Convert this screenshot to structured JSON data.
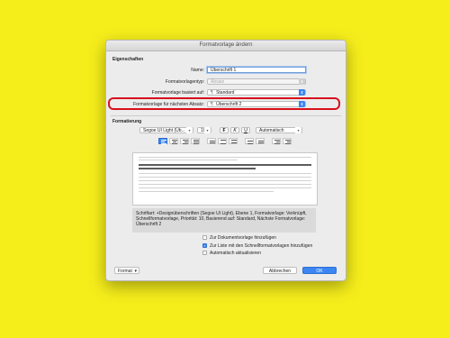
{
  "window": {
    "title": "Formatvorlage ändern"
  },
  "properties": {
    "heading": "Eigenschaften",
    "name_label": "Name:",
    "name_value": "Überschrift 1",
    "type_label": "Formatvorlagentyp:",
    "type_value": "Absatz",
    "based_on_label": "Formatvorlage basiert auf:",
    "based_on_value": "Standard",
    "next_label": "Formatvorlage für nächsten Absatz:",
    "next_value": "Überschrift 2",
    "paragraph_icon": "¶"
  },
  "formatting": {
    "heading": "Formatierung",
    "font": "Segoe UI Light (Üb...",
    "size": "10",
    "bold": "F",
    "italic": "K",
    "underline": "U",
    "color": "Automatisch"
  },
  "description": "Schriftart: +Designüberschriften (Segoe UI Light), Ebene 1, Formatvorlage: Verknüpft, Schnellformatvorlage, Priorität: 10, Basierend auf: Standard, Nächste Formatvorlage: Überschrift 2",
  "options": {
    "add_to_template": {
      "label": "Zur Dokumentvorlage hinzufügen",
      "checked": false
    },
    "add_to_quick_list": {
      "label": "Zur Liste mit den Schnellformatvorlagen hinzufügen",
      "checked": true
    },
    "auto_update": {
      "label": "Automatisch aktualisieren",
      "checked": false
    }
  },
  "footer": {
    "format_label": "Format",
    "cancel_label": "Abbrechen",
    "ok_label": "OK"
  },
  "colors": {
    "background": "#f6ee1b",
    "accent": "#3b86f2",
    "highlight": "#d8111c"
  }
}
